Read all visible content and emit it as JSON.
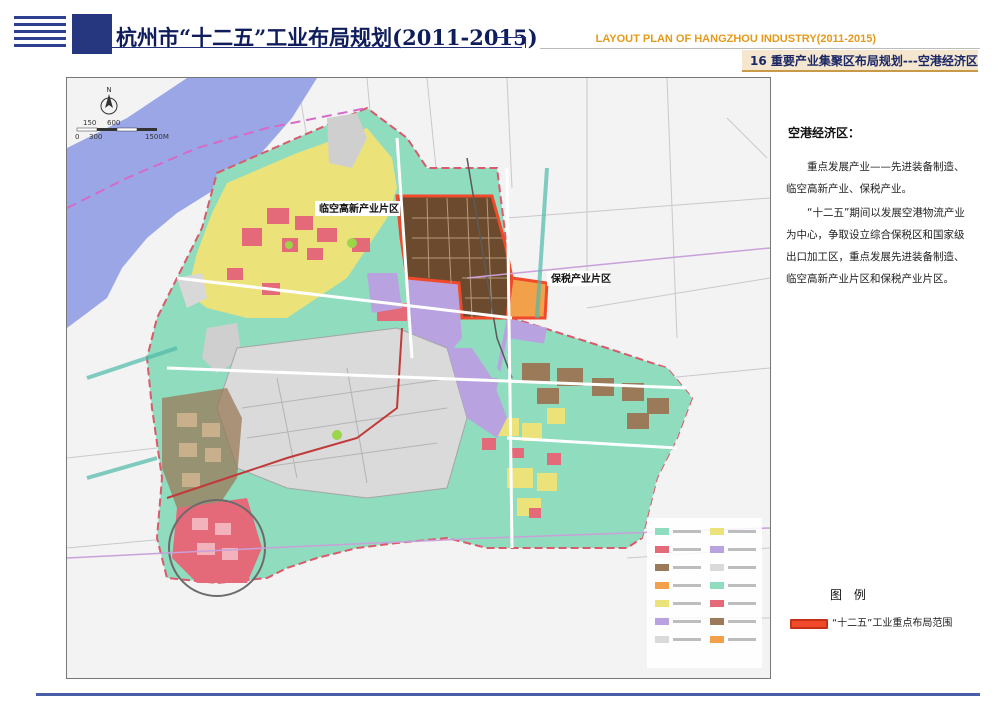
{
  "header": {
    "title_cn": "杭州市“十二五”工业布局规划(2011-2015)",
    "title_en": "LAYOUT PLAN OF HANGZHOU INDUSTRY(2011-2015)",
    "subtitle": "16 重要产业集聚区布局规划---空港经济区"
  },
  "map": {
    "labels": {
      "linkong": "临空高新产业片区",
      "baoshui": "保税产业片区"
    },
    "scale": {
      "tick_0": "0",
      "tick_150": "150",
      "tick_300": "300",
      "tick_600": "600",
      "tick_1500": "1500M"
    },
    "north": "N",
    "colors": {
      "river": "#9aa6e6",
      "industrial_green": "#8fdcbf",
      "residential_yellow": "#ece27a",
      "commercial_red": "#e46a7a",
      "airport_grey": "#dadada",
      "purple_zone": "#b9a2e0",
      "brown_zone": "#9a7a58",
      "highlight_core": "#6b4a2e",
      "highlight_border": "#f04a2a",
      "highlight_orange": "#f2a04a"
    }
  },
  "info": {
    "heading": "空港经济区：",
    "para1": "重点发展产业——先进装备制造、临空高新产业、保税产业。",
    "para2": "“十二五”期间以发展空港物流产业为中心，争取设立综合保税区和国家级出口加工区，重点发展先进装备制造、临空高新产业片区和保税产业片区。"
  },
  "legend": {
    "title": "图 例",
    "item_label": "“十二五”工业重点布局范围",
    "swatch_color": "#f04a2a"
  }
}
